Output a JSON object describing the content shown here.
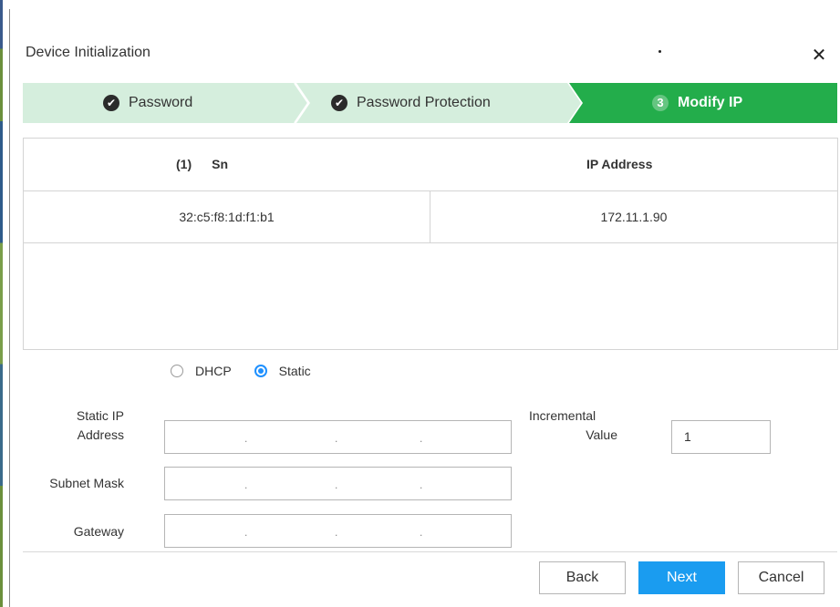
{
  "dialog": {
    "title": "Device Initialization"
  },
  "steps": [
    {
      "label": "Password",
      "state": "done",
      "icon": "check-icon"
    },
    {
      "label": "Password Protection",
      "state": "done",
      "icon": "check-icon"
    },
    {
      "number": "3",
      "label": "Modify IP",
      "state": "active"
    }
  ],
  "table": {
    "count": "(1)",
    "col_sn": "Sn",
    "col_ip": "IP Address",
    "rows": [
      {
        "sn": "32:c5:f8:1d:f1:b1",
        "ip": "172.11.1.90"
      }
    ]
  },
  "mode": {
    "dhcp_label": "DHCP",
    "static_label": "Static",
    "selected": "Static"
  },
  "form": {
    "static_ip_line1": "Static IP",
    "static_ip_line2": "Address",
    "subnet_label": "Subnet Mask",
    "gateway_label": "Gateway",
    "incremental_line1": "Incremental",
    "incremental_line2": "Value",
    "incremental_value": "1",
    "ip_separator": "."
  },
  "buttons": {
    "back": "Back",
    "next": "Next",
    "cancel": "Cancel"
  },
  "colors": {
    "step_done_bg": "#d5eedd",
    "step_active_bg": "#23ad4b",
    "primary_button": "#1a9cf0",
    "radio_selected": "#1e90ff"
  }
}
